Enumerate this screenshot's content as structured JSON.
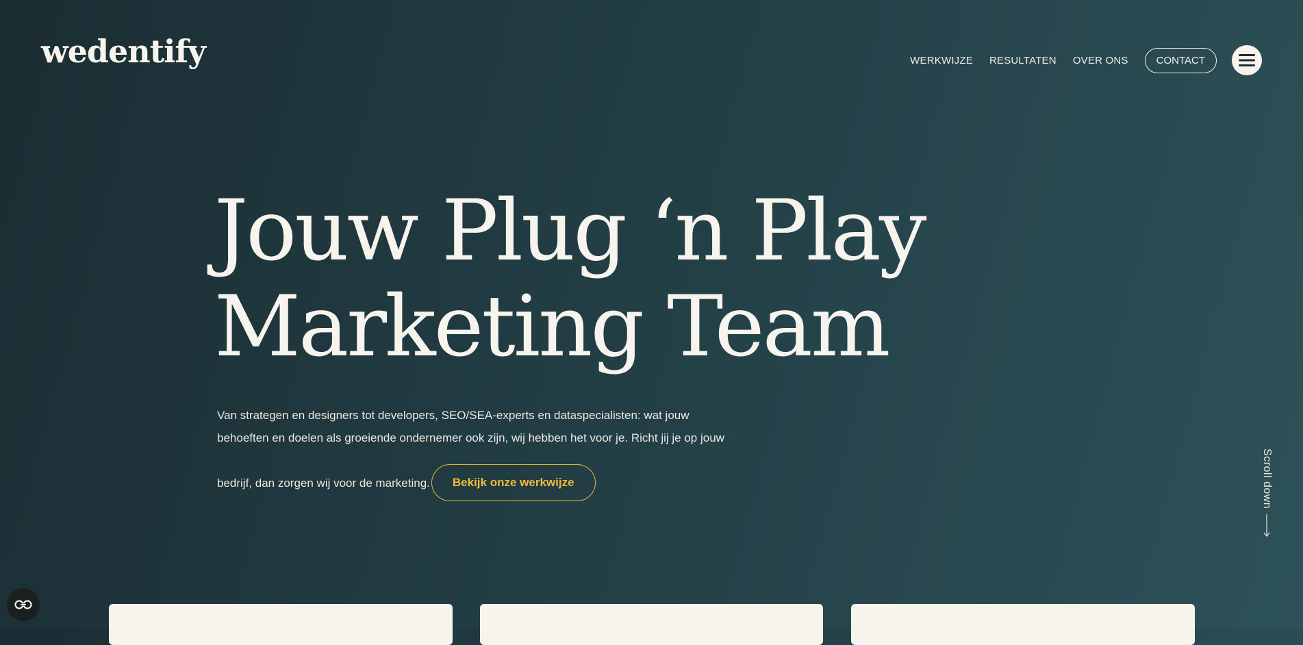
{
  "header": {
    "logo": "wedentify",
    "nav": [
      {
        "label": "WERKWIJZE"
      },
      {
        "label": "RESULTATEN"
      },
      {
        "label": "OVER ONS"
      }
    ],
    "contact_label": "CONTACT",
    "menu_icon": "hamburger-icon"
  },
  "hero": {
    "title_line1": "Jouw Plug ‘n Play",
    "title_line2": "Marketing Team",
    "text_line1": "Van strategen en designers tot developers, SEO/SEA-experts en dataspecialisten: wat jouw",
    "text_line2": "behoeften en doelen als groeiende ondernemer ook zijn, wij hebben het voor je. Richt jij je op jouw",
    "text_line3": "bedrijf, dan zorgen wij voor de marketing.",
    "cta_label": "Bekijk onze werkwijze"
  },
  "scroll": {
    "label": "Scroll down",
    "icon": "arrow-down-icon"
  },
  "accessibility": {
    "icon": "accessibility-icon"
  },
  "colors": {
    "accent": "#e9b53a",
    "background_dark": "#1b2d33",
    "background_light": "#2d5158",
    "text_light": "#f7f4ee"
  }
}
